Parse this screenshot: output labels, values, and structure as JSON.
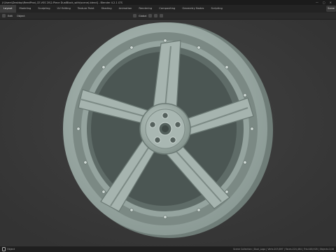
{
  "window": {
    "title": "J:\\Users\\Desktop\\ReedProd_CE-VSS 20\\2-Piece DualBlock_with(scene).blend] - Blender 4.2.1 LTS",
    "minimize": "—",
    "maximize": "▢",
    "close": "✕"
  },
  "workspace_tabs": [
    {
      "label": "Layout",
      "active": true
    },
    {
      "label": "Modeling"
    },
    {
      "label": "Sculpting"
    },
    {
      "label": "UV Editing"
    },
    {
      "label": "Texture Paint"
    },
    {
      "label": "Shading"
    },
    {
      "label": "Animation"
    },
    {
      "label": "Rendering"
    },
    {
      "label": "Compositing"
    },
    {
      "label": "Geometry Nodes"
    },
    {
      "label": "Scripting"
    }
  ],
  "scene_selector": "Scene",
  "viewport_header": {
    "menu_items": [
      "Edit",
      "Object"
    ],
    "transform_orientation": "Global",
    "pivot_icon": "pivot-icon",
    "snap_icon": "magnet-icon"
  },
  "status": {
    "left_label": "Object",
    "right_text": "Scene Collection | Dual_Logo | Verts:203,897 | Faces:224,464 | Tris:448,928 | Objects:1/16"
  },
  "colors": {
    "viewport_bg": "#3a3a3a",
    "wheel_base": "#9aaaa4",
    "wheel_shadow": "#5e6b67"
  }
}
